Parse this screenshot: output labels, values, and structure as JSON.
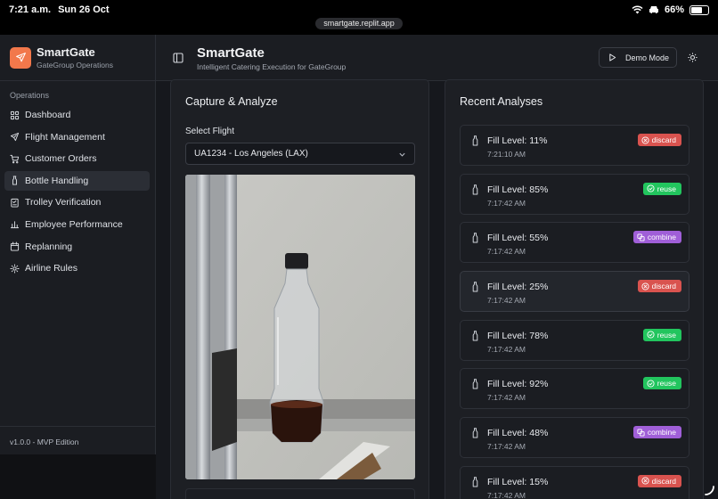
{
  "status_bar": {
    "time": "7:21 a.m.",
    "date": "Sun 26 Oct",
    "battery": "66%",
    "battery_level": 0.66
  },
  "browser": {
    "url": "smartgate.replit.app"
  },
  "sidebar": {
    "brand_title": "SmartGate",
    "brand_subtitle": "GateGroup Operations",
    "group_label": "Operations",
    "items": [
      {
        "label": "Dashboard",
        "icon": "grid-icon"
      },
      {
        "label": "Flight Management",
        "icon": "plane-icon"
      },
      {
        "label": "Customer Orders",
        "icon": "cart-icon"
      },
      {
        "label": "Bottle Handling",
        "icon": "bottle-icon",
        "active": true
      },
      {
        "label": "Trolley Verification",
        "icon": "checklist-icon"
      },
      {
        "label": "Employee Performance",
        "icon": "chart-icon"
      },
      {
        "label": "Replanning",
        "icon": "calendar-icon"
      },
      {
        "label": "Airline Rules",
        "icon": "gear-icon"
      }
    ],
    "version": "v1.0.0 - MVP Edition"
  },
  "header": {
    "title": "SmartGate",
    "subtitle": "Intelligent Catering Execution for GateGroup",
    "demo_button": "Demo Mode"
  },
  "capture": {
    "title": "Capture & Analyze",
    "select_label": "Select Flight",
    "selected_flight": "UA1234 - Los Angeles (LAX)"
  },
  "recent": {
    "title": "Recent Analyses",
    "items": [
      {
        "fill": "Fill Level: 11%",
        "time": "7:21:10 AM",
        "action": "discard"
      },
      {
        "fill": "Fill Level: 85%",
        "time": "7:17:42 AM",
        "action": "reuse"
      },
      {
        "fill": "Fill Level: 55%",
        "time": "7:17:42 AM",
        "action": "combine"
      },
      {
        "fill": "Fill Level: 25%",
        "time": "7:17:42 AM",
        "action": "discard"
      },
      {
        "fill": "Fill Level: 78%",
        "time": "7:17:42 AM",
        "action": "reuse"
      },
      {
        "fill": "Fill Level: 92%",
        "time": "7:17:42 AM",
        "action": "reuse"
      },
      {
        "fill": "Fill Level: 48%",
        "time": "7:17:42 AM",
        "action": "combine"
      },
      {
        "fill": "Fill Level: 15%",
        "time": "7:17:42 AM",
        "action": "discard"
      }
    ]
  },
  "colors": {
    "accent": "#f2784b",
    "discard": "#d9534f",
    "reuse": "#22c55e",
    "combine": "#a05fd8"
  }
}
